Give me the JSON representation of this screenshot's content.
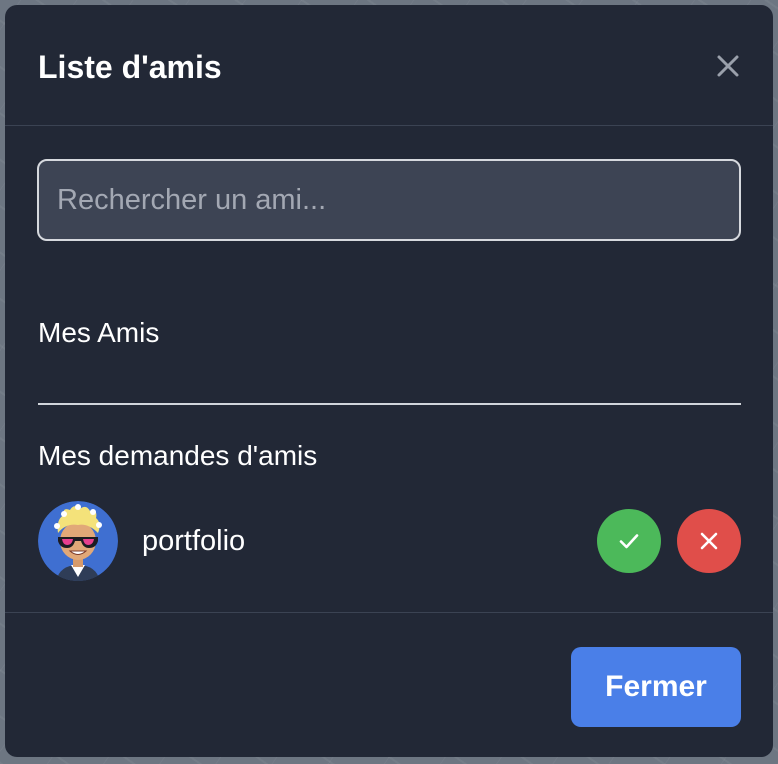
{
  "modal": {
    "title": "Liste d'amis",
    "close_icon": "close-icon"
  },
  "search": {
    "placeholder": "Rechercher un ami...",
    "value": ""
  },
  "sections": {
    "friends_title": "Mes Amis",
    "requests_title": "Mes demandes d'amis"
  },
  "requests": [
    {
      "name": "portfolio",
      "avatar_icon": "avatar-cartoon-sunglasses",
      "accept_icon": "check-icon",
      "decline_icon": "close-icon"
    }
  ],
  "footer": {
    "close_label": "Fermer"
  },
  "colors": {
    "modal_bg": "#222836",
    "input_bg": "#3d4454",
    "accept": "#4cb95a",
    "decline": "#e04e4a",
    "primary": "#4a7fe8",
    "avatar_bg": "#3f6fd1"
  }
}
